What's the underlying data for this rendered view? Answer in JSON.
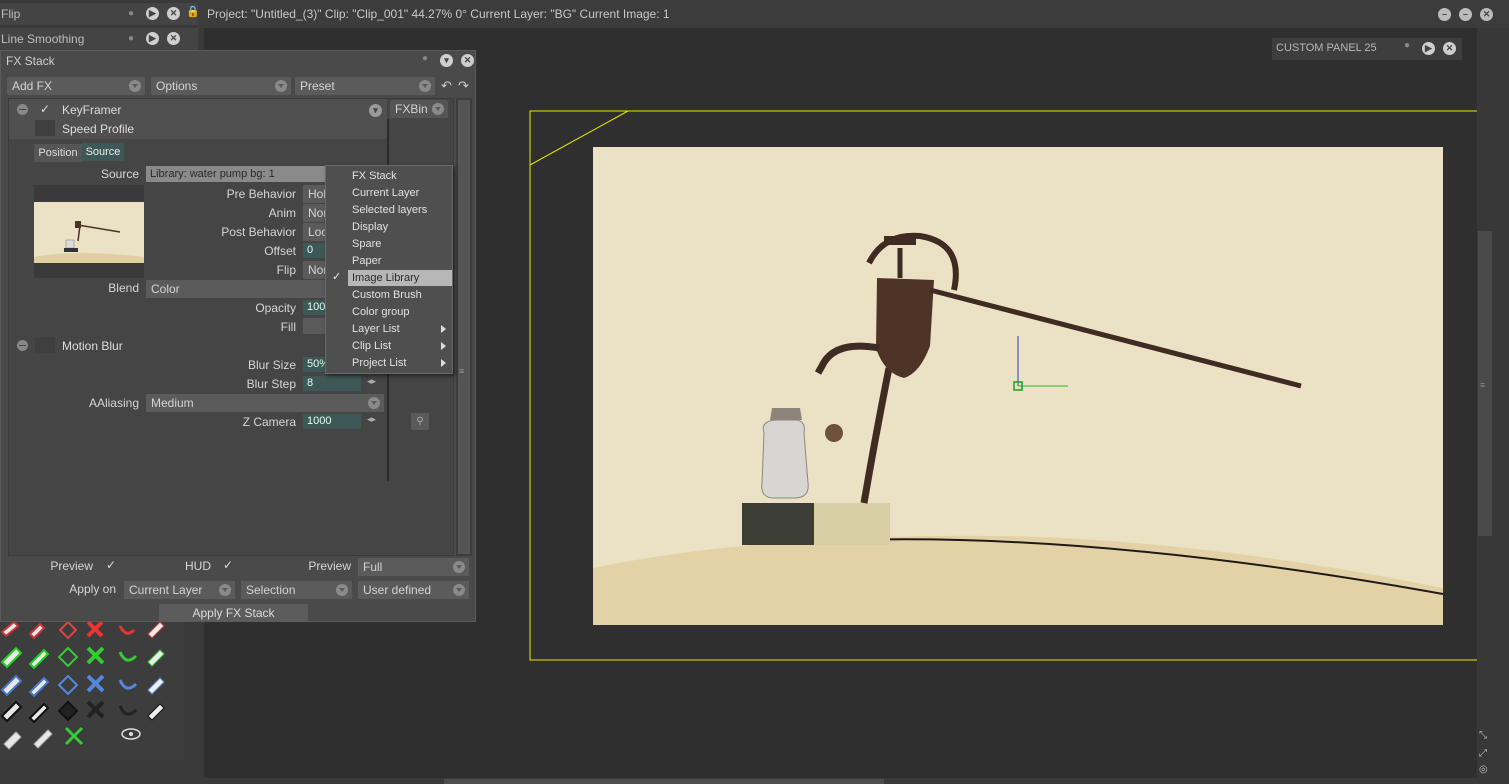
{
  "left_panels": {
    "flip": "Flip",
    "line_smoothing": "Line Smoothing"
  },
  "topbar": {
    "info": "Project:  \"Untitled_(3)\"  Clip: \"Clip_001\"   44.27%   0°  Current Layer: \"BG\"  Current Image: 1"
  },
  "custom_panel": {
    "title": "CUSTOM PANEL 25"
  },
  "fx_stack": {
    "title": "FX Stack",
    "add_fx": "Add FX",
    "options": "Options",
    "preset": "Preset",
    "keyframer": "KeyFramer",
    "fxbin": "FXBin",
    "speed_profile": "Speed Profile",
    "tab_position": "Position",
    "tab_source": "Source",
    "source_label": "Source",
    "source_value": "Library: water pump bg: 1",
    "pre_behavior_label": "Pre Behavior",
    "pre_behavior_value": "Hol",
    "anim_label": "Anim",
    "anim_value": "Nor",
    "post_behavior_label": "Post Behavior",
    "post_behavior_value": "Loo",
    "offset_label": "Offset",
    "offset_value": "0",
    "flip_label": "Flip",
    "flip_value": "Nor",
    "blend_label": "Blend",
    "blend_value": "Color",
    "opacity_label": "Opacity",
    "opacity_value": "100",
    "fill_label": "Fill",
    "motion_blur": "Motion Blur",
    "blur_size_label": "Blur Size",
    "blur_size_value": "50%",
    "blur_step_label": "Blur Step",
    "blur_step_value": "8",
    "aaliasing_label": "AAliasing",
    "aaliasing_value": "Medium",
    "z_camera_label": "Z Camera",
    "z_camera_value": "1000",
    "preview_label": "Preview",
    "hud_label": "HUD",
    "preview2_label": "Preview",
    "preview2_value": "Full",
    "apply_on_label": "Apply on",
    "apply_on_value": "Current Layer",
    "selection_value": "Selection",
    "user_defined_value": "User defined",
    "apply_button": "Apply FX Stack"
  },
  "source_menu": {
    "items": [
      {
        "label": "FX Stack"
      },
      {
        "label": "Current Layer"
      },
      {
        "label": "Selected layers"
      },
      {
        "label": "Display"
      },
      {
        "label": "Spare"
      },
      {
        "label": "Paper"
      },
      {
        "label": "Image Library",
        "checked": true
      },
      {
        "label": "Custom Brush"
      },
      {
        "label": "Color group"
      },
      {
        "label": "Layer List",
        "submenu": true
      },
      {
        "label": "Clip List",
        "submenu": true
      },
      {
        "label": "Project List",
        "submenu": true
      }
    ]
  },
  "colors": {
    "canvas_paper": "#ece3c6",
    "frame_border": "#e5e500",
    "pump": "#4a3327",
    "accent_green": "#3d5856"
  }
}
